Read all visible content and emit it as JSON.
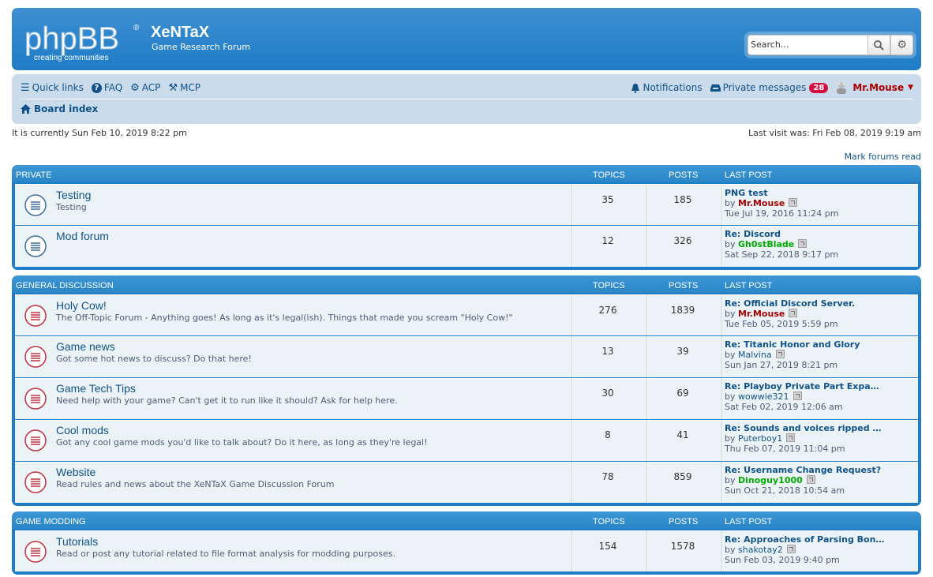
{
  "site": {
    "logo_text": "phpBB",
    "logo_tagline": "creating communities",
    "title": "XeNTaX",
    "subtitle": "Game Research Forum"
  },
  "search": {
    "placeholder": "Search…"
  },
  "nav": {
    "quick_links": "Quick links",
    "faq": "FAQ",
    "acp": "ACP",
    "mcp": "MCP",
    "notifications": "Notifications",
    "private_messages": "Private messages",
    "pm_count": "28",
    "username": "Mr.Mouse",
    "board_index": "Board index"
  },
  "status": {
    "current_time": "It is currently Sun Feb 10, 2019 8:22 pm",
    "last_visit": "Last visit was: Fri Feb 08, 2019 9:19 am",
    "mark_read": "Mark forums read"
  },
  "columns": {
    "topics": "TOPICS",
    "posts": "POSTS",
    "last_post": "LAST POST"
  },
  "categories": [
    {
      "name": "PRIVATE",
      "forums": [
        {
          "title": "Testing",
          "desc": "Testing",
          "topics": "35",
          "posts": "185",
          "lp_title": "PNG test",
          "lp_by": "by",
          "lp_user": "Mr.Mouse",
          "lp_user_color": "red",
          "lp_time": "Tue Jul 19, 2016 11:24 pm",
          "icon_color": "blue"
        },
        {
          "title": "Mod forum",
          "desc": "",
          "topics": "12",
          "posts": "326",
          "lp_title": "Re: Discord",
          "lp_by": "by",
          "lp_user": "Gh0stBlade",
          "lp_user_color": "green",
          "lp_time": "Sat Sep 22, 2018 9:17 pm",
          "icon_color": "blue"
        }
      ]
    },
    {
      "name": "GENERAL DISCUSSION",
      "forums": [
        {
          "title": "Holy Cow!",
          "desc": "The Off-Topic Forum - Anything goes! As long as it's legal(ish). Things that made you scream \"Holy Cow!\"",
          "topics": "276",
          "posts": "1839",
          "lp_title": "Re: Official Discord Server.",
          "lp_by": "by",
          "lp_user": "Mr.Mouse",
          "lp_user_color": "red",
          "lp_time": "Tue Feb 05, 2019 5:59 pm",
          "icon_color": "red"
        },
        {
          "title": "Game news",
          "desc": "Got some hot news to discuss? Do that here!",
          "topics": "13",
          "posts": "39",
          "lp_title": "Re: Titanic Honor and Glory",
          "lp_by": "by",
          "lp_user": "Malvina",
          "lp_user_color": "plain",
          "lp_time": "Sun Jan 27, 2019 8:21 pm",
          "icon_color": "red"
        },
        {
          "title": "Game Tech Tips",
          "desc": "Need help with your game? Can't get it to run like it should? Ask for help here.",
          "topics": "30",
          "posts": "69",
          "lp_title": "Re: Playboy Private Part Expa…",
          "lp_by": "by",
          "lp_user": "wowwie321",
          "lp_user_color": "plain",
          "lp_time": "Sat Feb 02, 2019 12:06 am",
          "icon_color": "red"
        },
        {
          "title": "Cool mods",
          "desc": "Got any cool game mods you'd like to talk about? Do it here, as long as they're legal!",
          "topics": "8",
          "posts": "41",
          "lp_title": "Re: Sounds and voices ripped …",
          "lp_by": "by",
          "lp_user": "Puterboy1",
          "lp_user_color": "plain",
          "lp_time": "Thu Feb 07, 2019 11:04 pm",
          "icon_color": "red"
        },
        {
          "title": "Website",
          "desc": "Read rules and news about the XeNTaX Game Discussion Forum",
          "topics": "78",
          "posts": "859",
          "lp_title": "Re: Username Change Request?",
          "lp_by": "by",
          "lp_user": "Dinoguy1000",
          "lp_user_color": "green",
          "lp_time": "Sun Oct 21, 2018 10:54 am",
          "icon_color": "red"
        }
      ]
    },
    {
      "name": "GAME MODDING",
      "forums": [
        {
          "title": "Tutorials",
          "desc": "Read or post any tutorial related to file format analysis for modding purposes.",
          "topics": "154",
          "posts": "1578",
          "lp_title": "Re: Approaches of Parsing Bon…",
          "lp_by": "by",
          "lp_user": "shakotay2",
          "lp_user_color": "plain",
          "lp_time": "Sun Feb 03, 2019 9:40 pm",
          "icon_color": "red"
        }
      ]
    }
  ]
}
